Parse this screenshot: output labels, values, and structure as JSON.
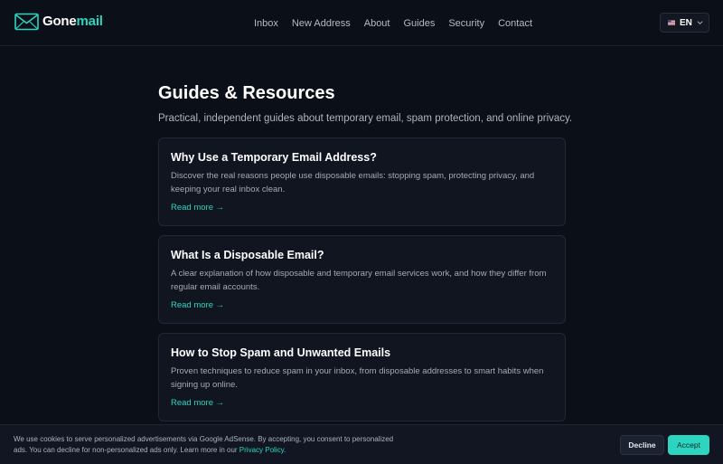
{
  "header": {
    "brand": {
      "part1": "Gone",
      "part2": "mail",
      "logo_icon": "envelope-icon",
      "accent_color": "#2dd4bf"
    },
    "nav": [
      "Inbox",
      "New Address",
      "About",
      "Guides",
      "Security",
      "Contact"
    ],
    "language": {
      "code": "EN",
      "flag_icon": "us-flag-icon",
      "dropdown_icon": "chevron-down-icon"
    }
  },
  "main": {
    "title": "Guides & Resources",
    "subtitle": "Practical, independent guides about temporary email, spam protection, and online privacy.",
    "cards": [
      {
        "title": "Why Use a Temporary Email Address?",
        "description": "Discover the real reasons people use disposable emails: stopping spam, protecting privacy, and keeping your real inbox clean.",
        "link": "Read more →"
      },
      {
        "title": "What Is a Disposable Email?",
        "description": "A clear explanation of how disposable and temporary email services work, and how they differ from regular email accounts.",
        "link": "Read more →"
      },
      {
        "title": "How to Stop Spam and Unwanted Emails",
        "description": "Proven techniques to reduce spam in your inbox, from disposable addresses to smart habits when signing up online.",
        "link": "Read more →"
      }
    ]
  },
  "cookie_banner": {
    "text": "We use cookies to serve personalized advertisements via Google AdSense. By accepting, you consent to personalized ads. You can decline for non-personalized ads only. Learn more in our ",
    "policy_link": "Privacy Policy",
    "text_end": ".",
    "decline_label": "Decline",
    "accept_label": "Accept"
  },
  "colors": {
    "background": "#0b0f17",
    "card_background": "#101520",
    "accent": "#2dd4bf"
  }
}
